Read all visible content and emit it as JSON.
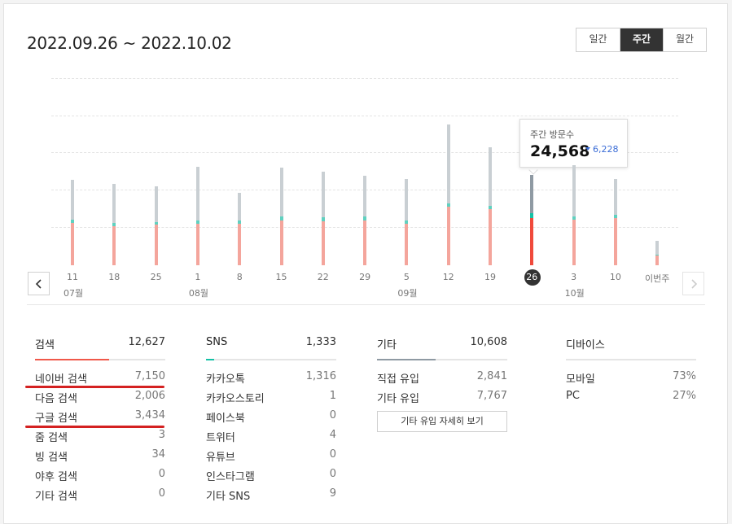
{
  "header": {
    "date_range": "2022.09.26 ~ 2022.10.02"
  },
  "period_tabs": [
    {
      "label": "일간",
      "active": false
    },
    {
      "label": "주간",
      "active": true
    },
    {
      "label": "월간",
      "active": false
    }
  ],
  "chart_data": {
    "type": "bar",
    "stacked": true,
    "categories": [
      "11",
      "18",
      "25",
      "1",
      "8",
      "15",
      "22",
      "29",
      "5",
      "12",
      "19",
      "26",
      "3",
      "10",
      "이번주"
    ],
    "month_labels": [
      {
        "text": "07월",
        "at_index": 0
      },
      {
        "text": "08월",
        "at_index": 3
      },
      {
        "text": "09월",
        "at_index": 8
      },
      {
        "text": "10월",
        "at_index": 12
      }
    ],
    "series": [
      {
        "name": "",
        "color": "#f4a59c",
        "values": [
          11500,
          10700,
          11000,
          11300,
          11400,
          12300,
          12000,
          12300,
          11300,
          15900,
          15300,
          12800,
          12400,
          12800,
          2800
        ]
      },
      {
        "name": "",
        "color": "#5fd1c0",
        "values": [
          900,
          850,
          800,
          850,
          700,
          1000,
          1000,
          1000,
          900,
          850,
          900,
          1333,
          1000,
          1000,
          100
        ]
      },
      {
        "name": "",
        "color": "#c9cfd3",
        "values": [
          10800,
          10600,
          9800,
          14600,
          7700,
          13400,
          12400,
          11200,
          11300,
          21600,
          15900,
          10435,
          13800,
          9800,
          3800
        ]
      }
    ],
    "ylim": [
      0,
      51000
    ],
    "grid": true,
    "selected_index": 11
  },
  "tooltip": {
    "label": "주간 방문수",
    "value": "24,568",
    "delta": "6,228"
  },
  "nav": {
    "prev_icon": "chevron-left-icon",
    "next_icon": "chevron-right-icon"
  },
  "stats": {
    "search": {
      "title": "검색",
      "total": "12,627",
      "accent": "#f0584a",
      "fill_ratio": 0.57,
      "rows": [
        {
          "label": "네이버 검색",
          "value": "7,150"
        },
        {
          "label": "다음 검색",
          "value": "2,006"
        },
        {
          "label": "구글 검색",
          "value": "3,434"
        },
        {
          "label": "줌 검색",
          "value": "3"
        },
        {
          "label": "빙 검색",
          "value": "34"
        },
        {
          "label": "야후 검색",
          "value": "0"
        },
        {
          "label": "기타 검색",
          "value": "0"
        }
      ]
    },
    "sns": {
      "title": "SNS",
      "total": "1,333",
      "accent": "#14c1a6",
      "fill_ratio": 0.06,
      "rows": [
        {
          "label": "카카오톡",
          "value": "1,316"
        },
        {
          "label": "카카오스토리",
          "value": "1"
        },
        {
          "label": "페이스북",
          "value": "0"
        },
        {
          "label": "트위터",
          "value": "4"
        },
        {
          "label": "유튜브",
          "value": "0"
        },
        {
          "label": "인스타그램",
          "value": "0"
        },
        {
          "label": "기타 SNS",
          "value": "9"
        }
      ]
    },
    "etc": {
      "title": "기타",
      "total": "10,608",
      "accent": "#8f9aa3",
      "fill_ratio": 0.45,
      "rows": [
        {
          "label": "직접 유입",
          "value": "2,841"
        },
        {
          "label": "기타 유입",
          "value": "7,767"
        }
      ],
      "detail_button": "기타 유입 자세히 보기"
    },
    "device": {
      "title": "디바이스",
      "total": "",
      "accent": "#e5e5e5",
      "fill_ratio": 0,
      "rows": [
        {
          "label": "모바일",
          "value": "73%"
        },
        {
          "label": "PC",
          "value": "27%"
        }
      ]
    }
  }
}
